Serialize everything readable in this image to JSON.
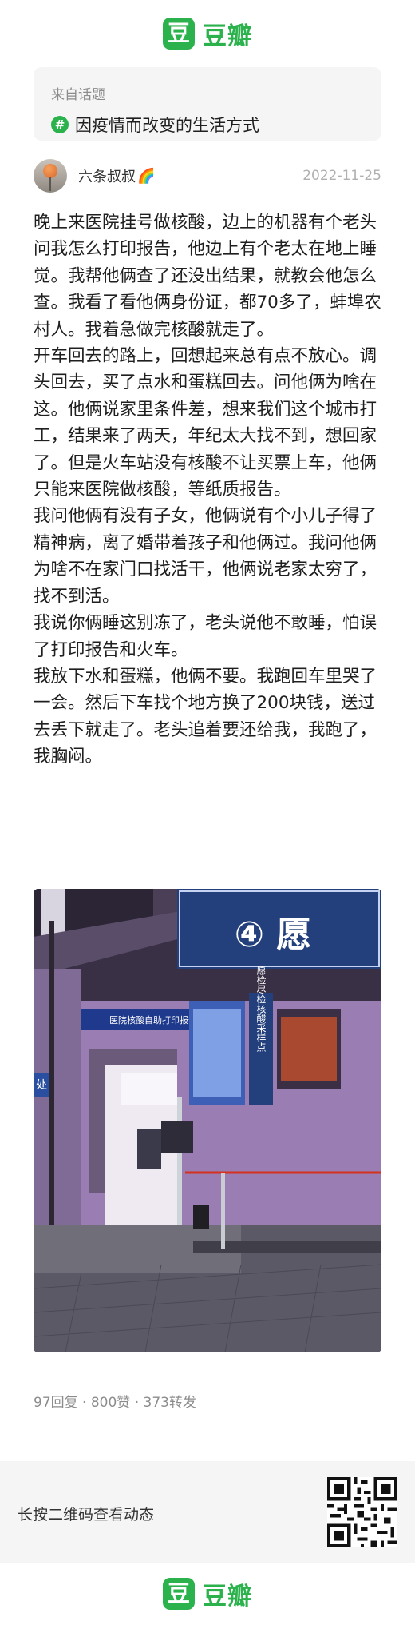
{
  "brand": {
    "logo_char": "豆",
    "name": "豆瓣"
  },
  "topic": {
    "from_label": "来自话题",
    "hash_symbol": "#",
    "title": "因疫情而改变的生活方式"
  },
  "author": {
    "name": "六条叔叔",
    "badge": "🌈",
    "date": "2022-11-25"
  },
  "post": {
    "paragraphs": [
      "晚上来医院挂号做核酸，边上的机器有个老头问我怎么打印报告，他边上有个老太在地上睡觉。我帮他俩查了还没出结果，就教会他怎么查。我看了看他俩身份证，都70多了，蚌埠农村人。我着急做完核酸就走了。",
      "开车回去的路上，回想起来总有点不放心。调头回去，买了点水和蛋糕回去。问他俩为啥在这。他俩说家里条件差，想来我们这个城市打工，结果来了两天，年纪太大找不到，想回家了。但是火车站没有核酸不让买票上车，他俩只能来医院做核酸，等纸质报告。",
      "我问他俩有没有子女，他俩说有个小儿子得了精神病，离了婚带着孩子和他俩过。我问他俩为啥不在家门口找活干，他俩说老家太穷了，找不到活。",
      "我说你俩睡这别冻了，老头说他不敢睡，怕误了打印报告和火车。",
      "我放下水和蛋糕，他俩不要。我跑回车里哭了一会。然后下车找个地方换了200块钱，送过去丢下就走了。老头追着要还给我，我跑了，我胸闷。"
    ]
  },
  "photo": {
    "sign_big": "④ 愿",
    "sign_side": "愿检尽检核酸采样点",
    "sign_left": "医院核酸自助打印报告",
    "sign_corner": "处"
  },
  "stats": "97回复 · 800赞 · 373转发",
  "footer": {
    "qr_hint": "长按二维码查看动态"
  },
  "colors": {
    "brand_green": "#2bb24c",
    "muted": "#8c8c8c",
    "panel": "#f5f5f5"
  }
}
